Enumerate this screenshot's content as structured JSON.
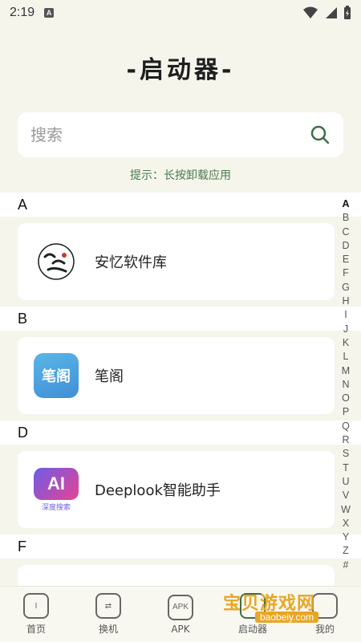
{
  "status_bar": {
    "time": "2:19",
    "notif_letter": "A"
  },
  "title": "-启动器-",
  "search": {
    "placeholder": "搜索"
  },
  "hint": "提示：长按卸载应用",
  "groups": [
    {
      "letter": "A",
      "app": {
        "name": "安忆软件库",
        "icon": "anyi-logo-icon"
      }
    },
    {
      "letter": "B",
      "app": {
        "name": "笔阁",
        "icon_text": "笔阁"
      }
    },
    {
      "letter": "D",
      "app": {
        "name": "Deeplook智能助手",
        "icon_text": "AI",
        "icon_sub": "深度搜索"
      }
    },
    {
      "letter": "F"
    }
  ],
  "alphabet": [
    "A",
    "B",
    "C",
    "D",
    "E",
    "F",
    "G",
    "H",
    "I",
    "J",
    "K",
    "L",
    "M",
    "N",
    "O",
    "P",
    "Q",
    "R",
    "S",
    "T",
    "U",
    "V",
    "W",
    "X",
    "Y",
    "Z",
    "#"
  ],
  "bottom_nav": [
    {
      "label": "首页",
      "icon_text": "I"
    },
    {
      "label": "换机",
      "icon_text": "⇄"
    },
    {
      "label": "APK",
      "icon_text": "APK"
    },
    {
      "label": "启动器",
      "icon_text": ""
    },
    {
      "label": "我的",
      "icon_text": ""
    }
  ],
  "watermark": {
    "text": "宝贝游戏网",
    "url": "baobeiy.com"
  },
  "colors": {
    "background": "#f5f5ec",
    "hint": "#4a7a4e",
    "search_icon": "#3f6e45"
  }
}
